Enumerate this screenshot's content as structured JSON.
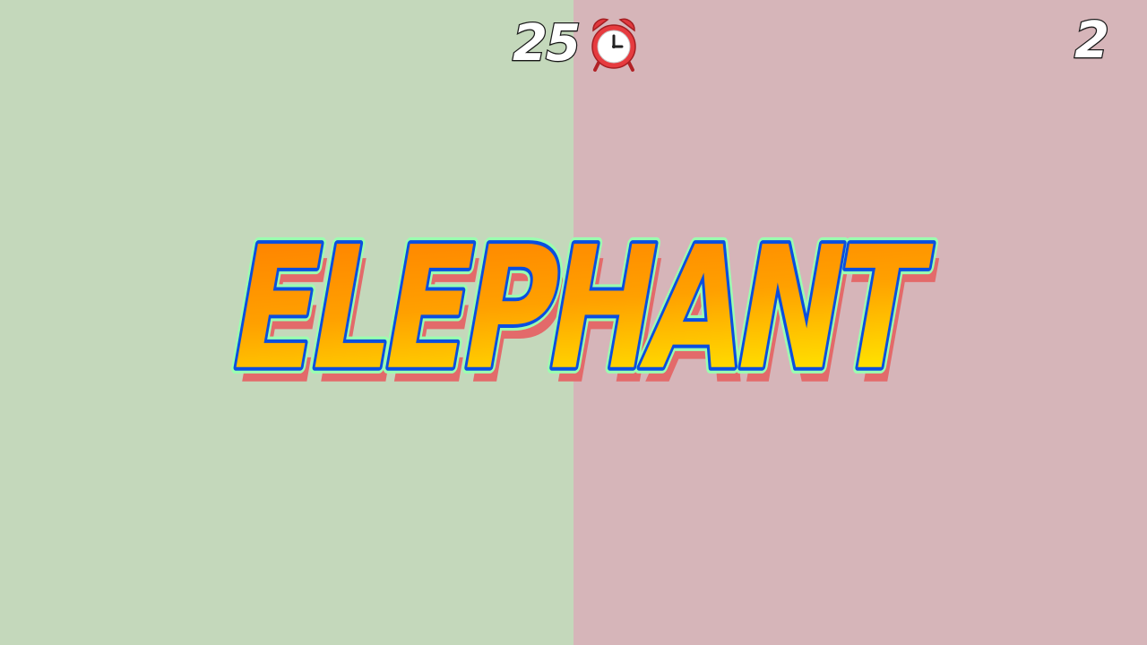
{
  "colors": {
    "left_panel": "#c4d8bb",
    "right_panel": "#d6b5b9",
    "word_fill_top": "#ff7a00",
    "word_fill_bottom": "#ffe600",
    "word_outline": "#0a4ee0",
    "word_glow": "#9bffb0",
    "word_shadow": "#e36a6a"
  },
  "hud": {
    "timer": "25",
    "timer_icon": "alarm-clock-icon",
    "score": "2"
  },
  "prompt": {
    "word": "ELEPHANT"
  }
}
